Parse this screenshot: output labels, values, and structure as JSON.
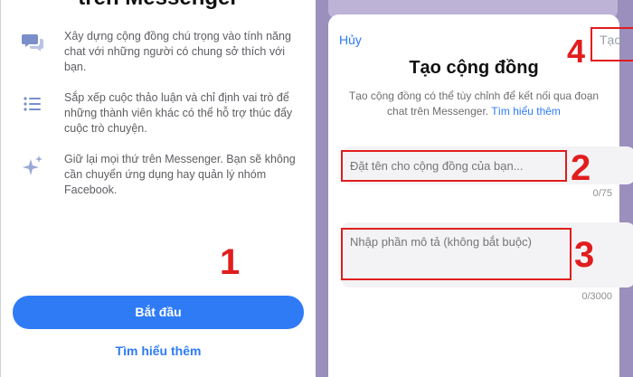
{
  "left": {
    "title": "trên Messenger",
    "features": [
      {
        "icon": "chat-bubbles-icon",
        "text": "Xây dựng cộng đồng chú trọng vào tính năng chat với những người có chung sở thích với bạn."
      },
      {
        "icon": "list-icon",
        "text": "Sắp xếp cuộc thảo luận và chỉ định vai trò để những thành viên khác có thể hỗ trợ thúc đẩy cuộc trò chuyện."
      },
      {
        "icon": "sparkles-icon",
        "text": "Giữ lại mọi thứ trên Messenger. Bạn sẽ không cần chuyển ứng dụng hay quản lý nhóm Facebook."
      }
    ],
    "start_button": "Bắt đầu",
    "learn_more": "Tìm hiểu thêm",
    "annotation": "1"
  },
  "right": {
    "cancel": "Hủy",
    "create": "Tạo",
    "title": "Tạo cộng đồng",
    "description": "Tạo cộng đồng có thể tùy chỉnh để kết nối qua đoạn chat trên Messenger.",
    "description_link": "Tìm hiểu thêm",
    "name_placeholder": "Đặt tên cho cộng đồng của bạn...",
    "name_counter": "0/75",
    "desc_placeholder": "Nhập phần mô tả (không bắt buộc)",
    "desc_counter": "0/3000",
    "annotations": {
      "name": "2",
      "desc": "3",
      "create": "4"
    }
  },
  "colors": {
    "accent": "#2f7bf6",
    "annotation": "#e11d1d",
    "overlay": "#9b8fbd"
  }
}
